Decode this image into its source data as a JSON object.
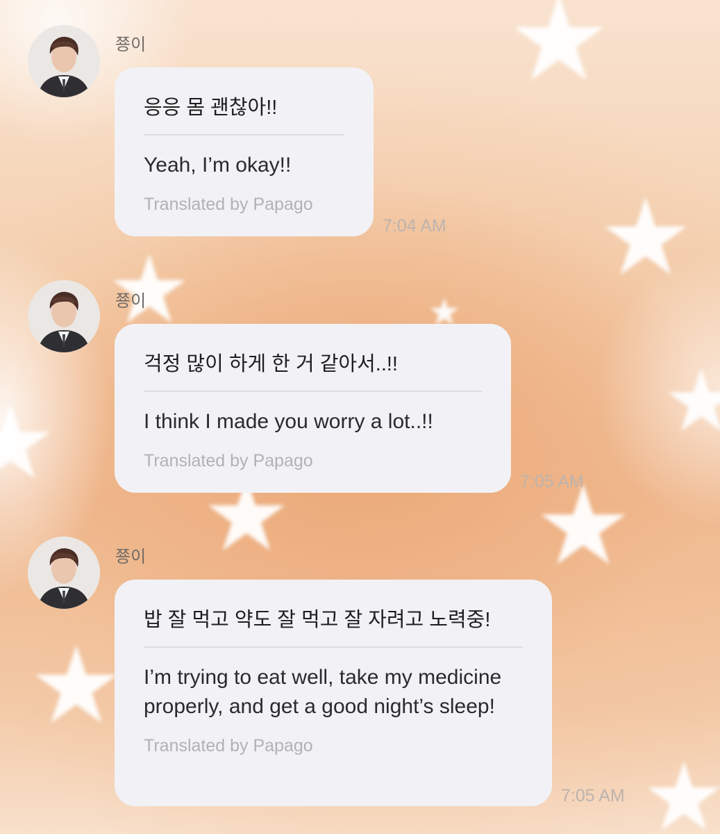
{
  "messages": [
    {
      "sender": "쭁이",
      "original": "응응 몸 괜찮아!!",
      "translation": "Yeah, I’m okay!!",
      "credit": "Translated by Papago",
      "time": "7:04 AM"
    },
    {
      "sender": "쭁이",
      "original": "걱정 많이 하게 한 거 같아서..!!",
      "translation": "I think I made you worry a lot..!!",
      "credit": "Translated by Papago",
      "time": "7:05 AM"
    },
    {
      "sender": "쭁이",
      "original": "밥 잘 먹고 약도 잘 먹고 잘 자려고 노력중!",
      "translation": "I’m trying to eat well, take my medicine properly, and get a good night’s sleep!",
      "credit": "Translated by Papago",
      "time": "7:05 AM"
    }
  ],
  "colors": {
    "bubble": "#f2f2f6",
    "background": "#efb78c",
    "credit_text": "#b1b1b6"
  }
}
